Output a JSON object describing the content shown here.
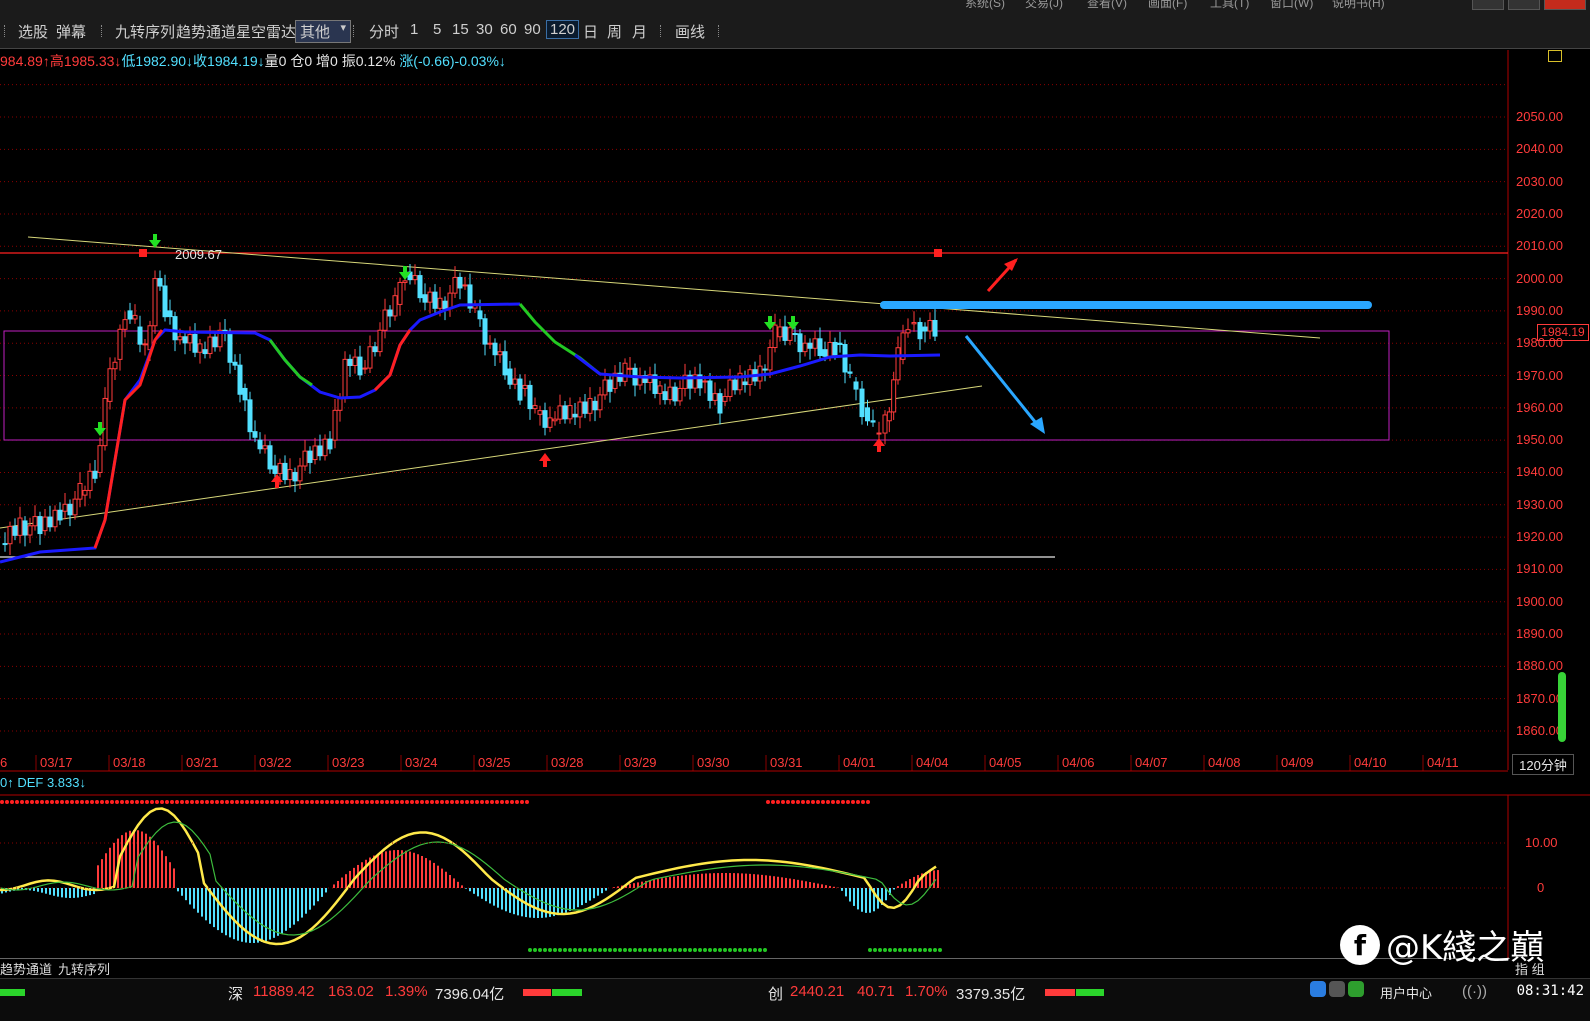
{
  "menu": {
    "items": [
      "系统(S)",
      "交易(J)",
      "查看(V)",
      "画面(F)",
      "工具(T)",
      "窗口(W)",
      "说明书(H)"
    ]
  },
  "toolbar": {
    "items": [
      "选股",
      "弹幕",
      "九转序列",
      "趋势通道",
      "星空雷达"
    ],
    "combo": "其他",
    "periods": [
      "分时",
      "1",
      "5",
      "15",
      "30",
      "60",
      "90",
      "120",
      "日",
      "周",
      "月"
    ],
    "selected_period": "120",
    "draw": "画线"
  },
  "info": {
    "open": "984.89↑",
    "high": "高1985.33↓",
    "low": "低1982.90↓",
    "close": "收1984.19↓",
    "vol": "量0",
    "pos": "仓0",
    "inc": "增0",
    "amp": "振0.12%",
    "chg": "涨(-0.66)-0.03%↓"
  },
  "chart": {
    "current_price": "1984.19",
    "high_annotation": "2009.67",
    "period": "120分钟",
    "y_ticks": [
      "2050.00",
      "2040.00",
      "2030.00",
      "2020.00",
      "2010.00",
      "2000.00",
      "1990.00",
      "1980.00",
      "1970.00",
      "1960.00",
      "1950.00",
      "1940.00",
      "1930.00",
      "1920.00",
      "1910.00",
      "1900.00",
      "1890.00",
      "1880.00",
      "1870.00",
      "1860.00"
    ],
    "dates": [
      "6",
      "03/17",
      "03/18",
      "03/21",
      "03/22",
      "03/23",
      "03/24",
      "03/25",
      "03/28",
      "03/29",
      "03/30",
      "03/31",
      "04/01",
      "04/04",
      "04/05",
      "04/06",
      "04/07",
      "04/08",
      "04/09",
      "04/10",
      "04/11"
    ]
  },
  "chart_data": {
    "type": "line",
    "title": "",
    "y_range": [
      1855,
      2060
    ],
    "reference_lines": {
      "resistance_high": 2009.67,
      "box_top": 1984.5,
      "box_bottom": 1950.5,
      "support_low": 1915
    },
    "last_price": 1984.19
  },
  "indicator": {
    "label": "0↑  DEF 3.833↓",
    "ticks": [
      "10.00",
      "0"
    ]
  },
  "bottom_tabs": [
    "趋势通道",
    "九转序列"
  ],
  "zhibiao": "指 组",
  "status": {
    "sz_name": "深",
    "sz_index": "11889.42",
    "sz_change": "163.02",
    "sz_pct": "1.39%",
    "sz_amount": "7396.04亿",
    "cy_name": "创",
    "cy_index": "2440.21",
    "cy_change": "40.71",
    "cy_pct": "1.70%",
    "cy_amount": "3379.35亿",
    "user_center": "用户中心",
    "time": "08:31:42"
  },
  "watermark": {
    "text": "@K綫之巔"
  },
  "colors": {
    "up": "#ff3b3b",
    "down": "#52e0ff",
    "grid": "#8a0000",
    "box": "#c020c0",
    "ma_blue": "#1a1aff"
  }
}
